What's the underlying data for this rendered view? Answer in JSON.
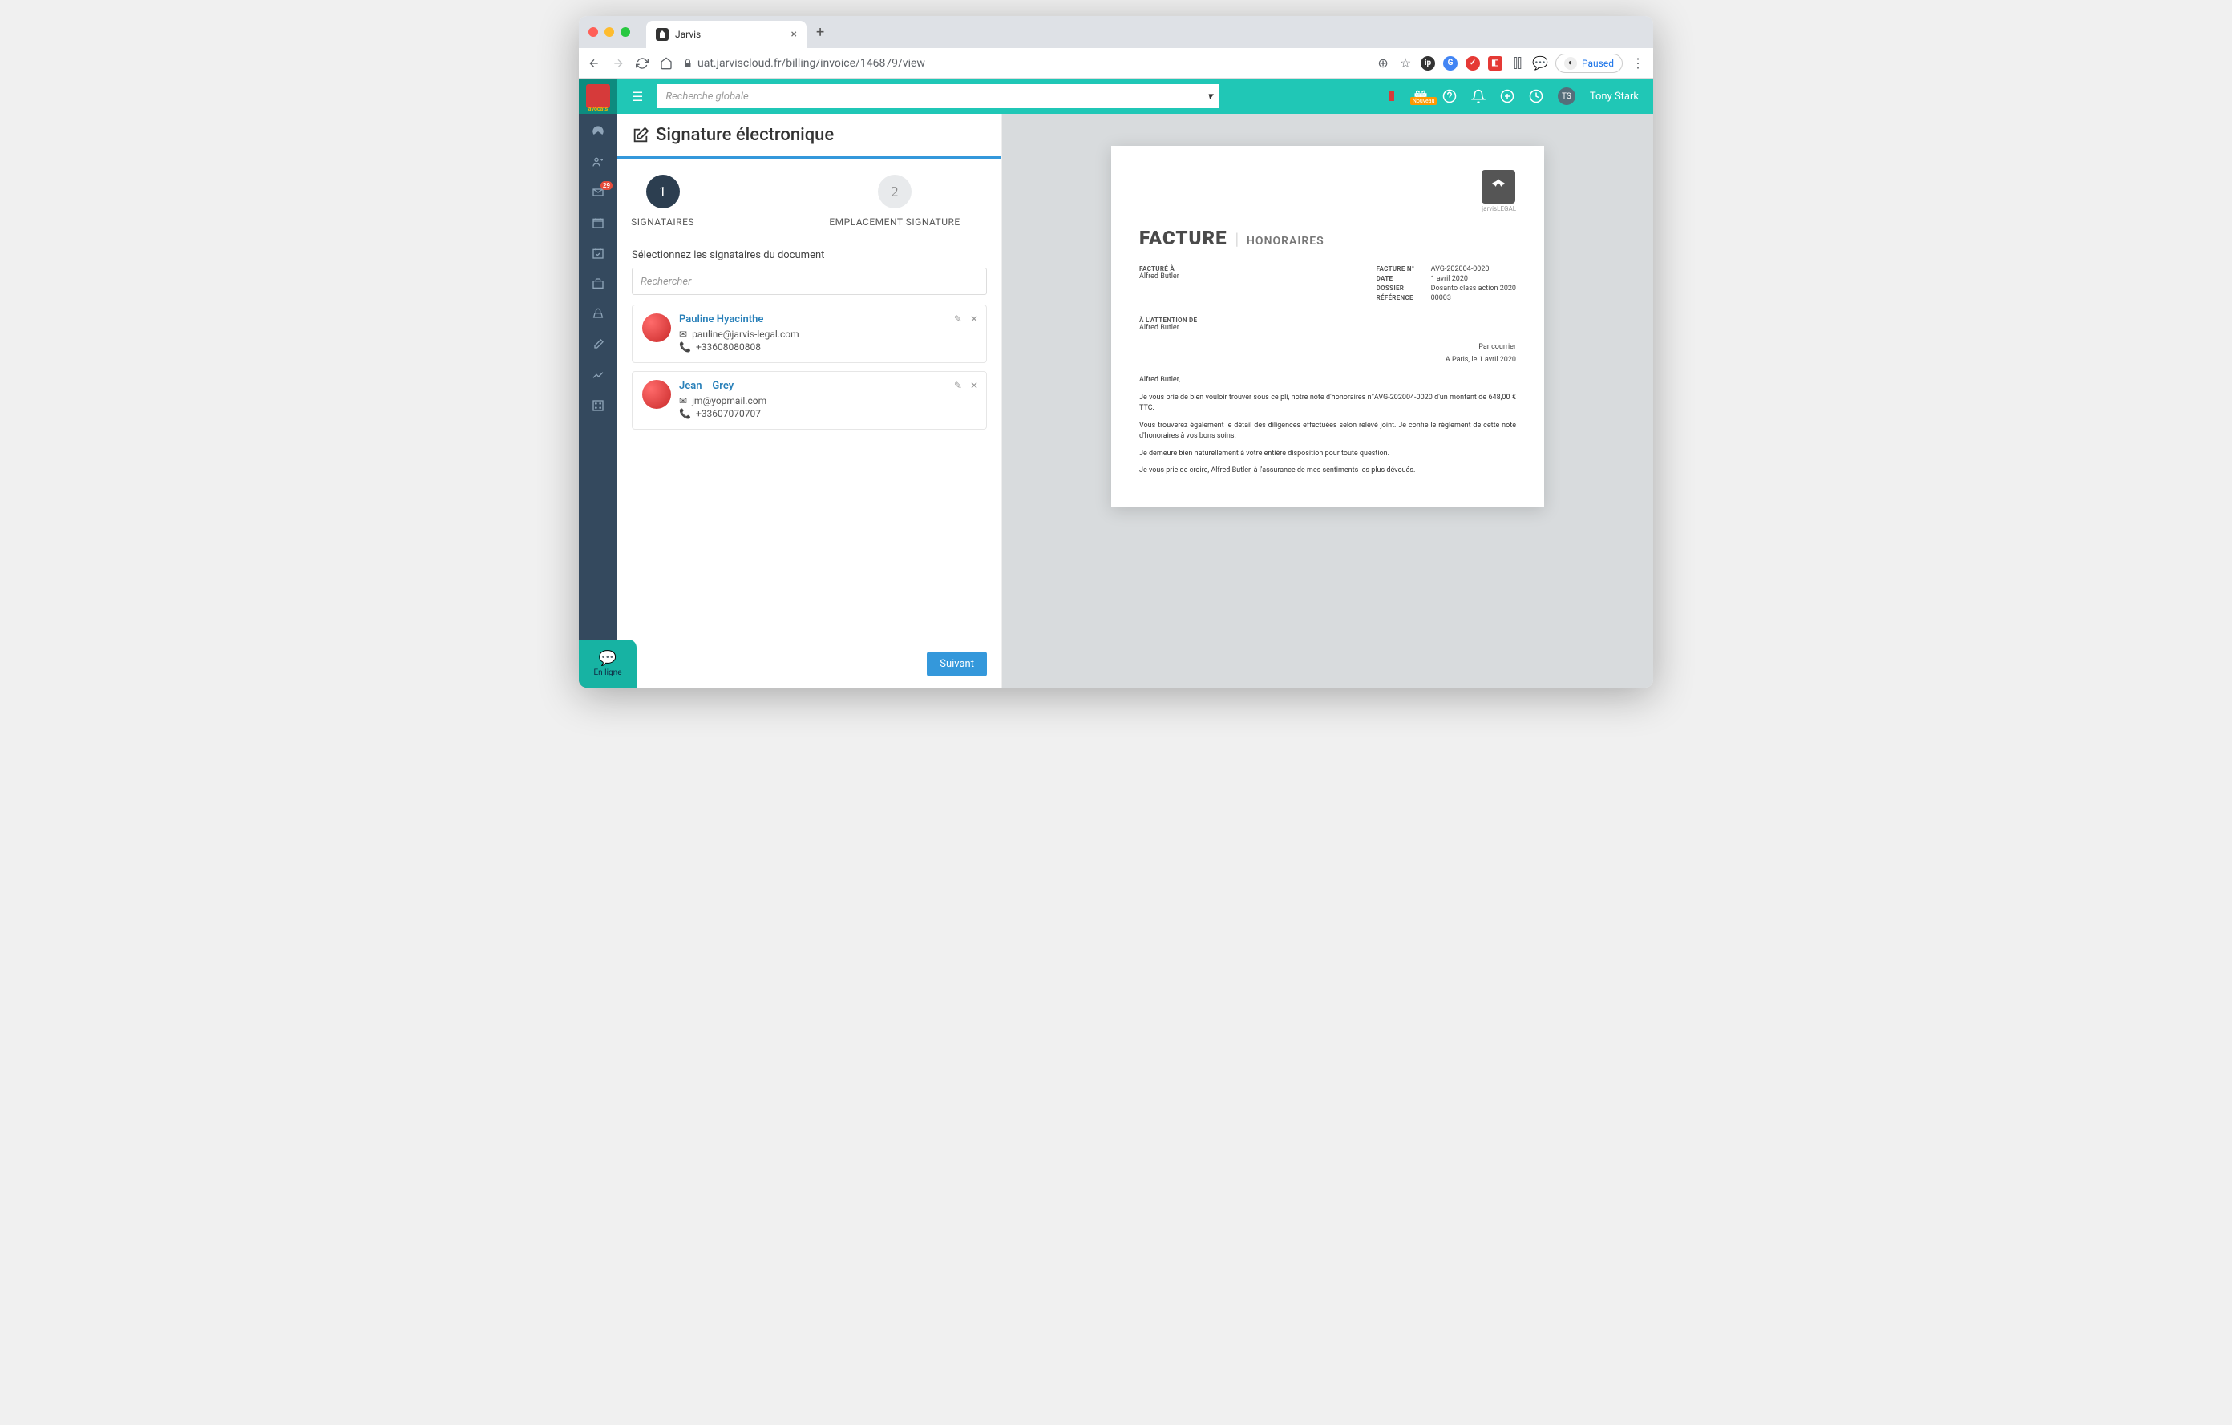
{
  "browser": {
    "tab_title": "Jarvis",
    "url": "uat.jarviscloud.fr/billing/invoice/146879/view",
    "paused_label": "Paused"
  },
  "topbar": {
    "brand_text": "avocats",
    "search_placeholder": "Recherche globale",
    "gift_badge": "Nouveau",
    "user_initials": "TS",
    "user_name": "Tony Stark"
  },
  "sidenav": {
    "mail_badge": "29",
    "chat_label": "En ligne"
  },
  "page": {
    "title": "Signature électronique",
    "step1_label": "SIGNATAIRES",
    "step2_label": "EMPLACEMENT SIGNATURE",
    "section_label": "Sélectionnez les signataires du document",
    "search_placeholder": "Rechercher",
    "next_button": "Suivant"
  },
  "signers": [
    {
      "name": "Pauline Hyacinthe",
      "email": "pauline@jarvis-legal.com",
      "phone": "+33608080808"
    },
    {
      "name": "Jean    Grey",
      "email": "jm@yopmail.com",
      "phone": "+33607070707"
    }
  ],
  "invoice": {
    "logo_sub": "jarvisLEGAL",
    "title_main": "FACTURE",
    "title_sub": "HONORAIRES",
    "billed_to_label": "FACTURÉ À",
    "billed_to": "Alfred Butler",
    "number_label": "FACTURE N°",
    "number": "AVG-202004-0020",
    "date_label": "DATE",
    "date": "1 avril 2020",
    "dossier_label": "DOSSIER",
    "dossier": "Dosanto class action 2020",
    "ref_label": "RÉFÉRENCE",
    "ref": "00003",
    "attn_label": "À L'ATTENTION DE",
    "attn": "Alfred Butler",
    "delivery": "Par courrier",
    "place_date": "A Paris, le 1 avril 2020",
    "greeting": "Alfred Butler,",
    "p1": "Je vous prie de bien vouloir trouver sous ce pli, notre note d'honoraires n°AVG-202004-0020 d'un montant de 648,00 € TTC.",
    "p2": "Vous trouverez également le détail des diligences effectuées selon relevé joint. Je confie le règlement de cette note d'honoraires à vos bons soins.",
    "p3": "Je demeure bien naturellement à votre entière disposition pour toute question.",
    "p4": "Je vous prie de croire,  Alfred Butler, à l'assurance de mes sentiments les plus dévoués."
  }
}
